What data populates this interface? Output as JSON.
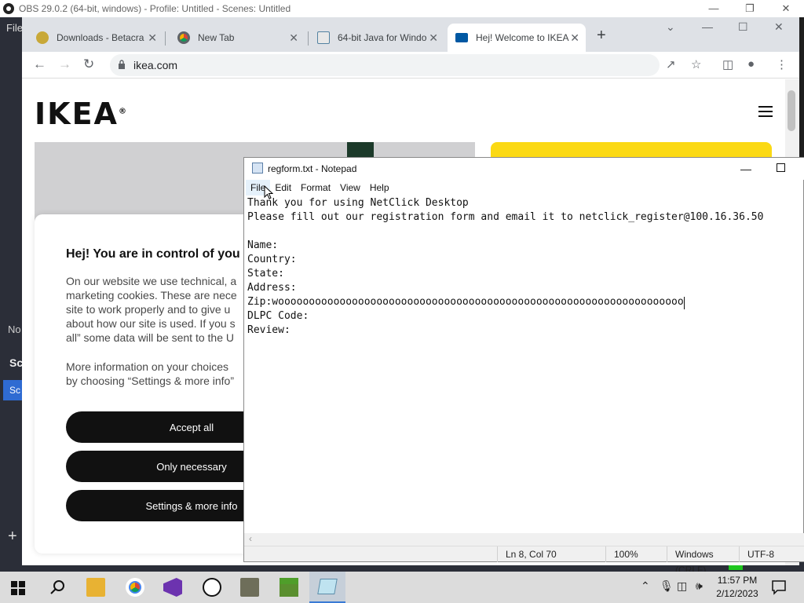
{
  "obs": {
    "title": "OBS 29.0.2 (64-bit, windows) - Profile: Untitled - Scenes: Untitled",
    "menu_file": "File",
    "partial_labels": {
      "no": "No",
      "sc": "Sc",
      "sc_item": "Sc"
    }
  },
  "chrome": {
    "tabs": [
      {
        "label": "Downloads - Betacra",
        "icon": "betacraft-icon"
      },
      {
        "label": "New Tab",
        "icon": "chrome-icon"
      },
      {
        "label": "64-bit Java for Windo",
        "icon": "java-icon"
      },
      {
        "label": "Hej! Welcome to IKEA",
        "icon": "ikea-icon"
      }
    ],
    "url": "ikea.com"
  },
  "ikea": {
    "logo": "IKEA",
    "logo_mark": "®",
    "cookie": {
      "heading": "Hej! You are in control of you",
      "para1": [
        "On our website we use technical, a",
        "marketing cookies. These are nece",
        "site to work properly and to give u",
        "about how our site is used. If you s",
        "all” some data will be sent to the U"
      ],
      "para2": [
        "More information on your choices",
        "by choosing “Settings & more info”"
      ],
      "buttons": {
        "accept": "Accept all",
        "necessary": "Only necessary",
        "settings": "Settings & more info"
      }
    },
    "colors": {
      "yellow": "#fbd914",
      "dark": "#111111"
    }
  },
  "notepad": {
    "title": "regform.txt - Notepad",
    "menu": [
      "File",
      "Edit",
      "Format",
      "View",
      "Help"
    ],
    "lines": [
      "Thank you for using NetClick Desktop",
      "Please fill out our registration form and email it to netclick_register@100.16.36.50",
      "",
      "Name:",
      "Country:",
      "State:",
      "Address:",
      "Zip:woooooooooooooooooooooooooooooooooooooooooooooooooooooooooooooooooo",
      "DLPC Code:",
      "Review:"
    ],
    "status": {
      "position": "Ln 8, Col 70",
      "zoom": "100%",
      "line_ending": "Windows (CRLF)",
      "encoding": "UTF-8"
    }
  },
  "taskbar": {
    "clock_time": "11:57 PM",
    "clock_date": "2/12/2023"
  }
}
